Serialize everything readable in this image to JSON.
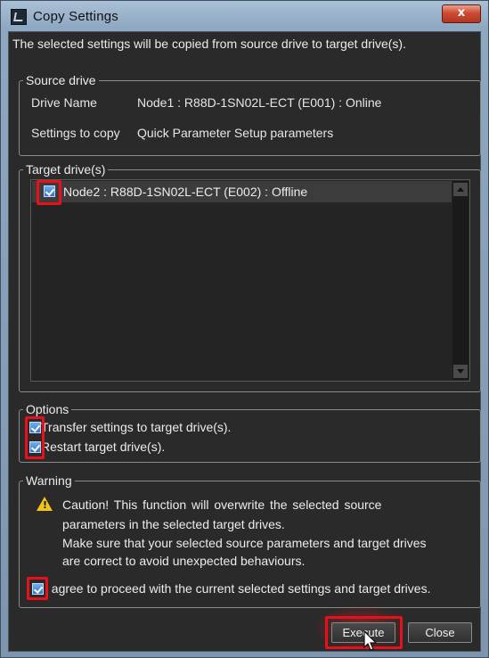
{
  "window": {
    "title": "Copy Settings",
    "close_glyph": "x"
  },
  "intro": "The selected settings will be copied from source drive to target drive(s).",
  "source": {
    "legend": "Source drive",
    "drive_name_label": "Drive Name",
    "drive_name_value": "Node1 : R88D-1SN02L-ECT (E001) : Online",
    "settings_label": "Settings to copy",
    "settings_value": "Quick Parameter Setup parameters"
  },
  "targets": {
    "legend": "Target drive(s)",
    "items": [
      {
        "label": "Node2 : R88D-1SN02L-ECT (E002) : Offline",
        "checked": true
      }
    ]
  },
  "options": {
    "legend": "Options",
    "items": [
      {
        "label": "Transfer settings to target drive(s).",
        "checked": true
      },
      {
        "label": "Restart target drive(s).",
        "checked": true
      }
    ]
  },
  "warning": {
    "legend": "Warning",
    "icon": "warning-triangle-icon",
    "lines": [
      "Caution!  This  function  will  overwrite  the  selected  source",
      "parameters in the selected target drives.",
      "Make sure that your selected source parameters and target drives",
      "are correct to avoid unexpected behaviours."
    ],
    "agree_label": "I agree to proceed with the current selected settings and target drives.",
    "agree_checked": true
  },
  "buttons": {
    "execute": "Execute",
    "close": "Close"
  },
  "colors": {
    "highlight": "#e8101b",
    "background": "#2a2a2a",
    "checkbox": "#2f79cf"
  }
}
